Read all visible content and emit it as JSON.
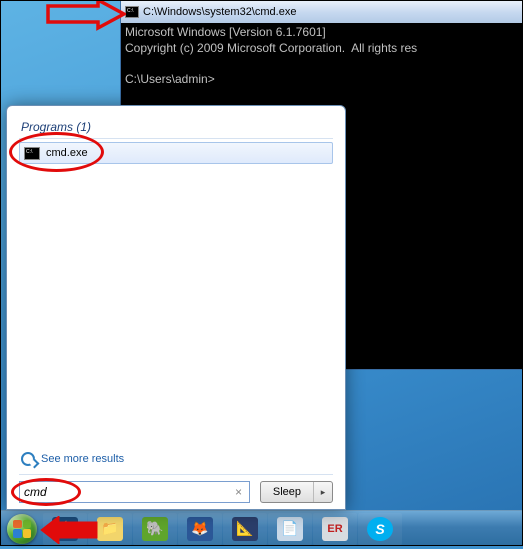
{
  "cmd": {
    "title": "C:\\Windows\\system32\\cmd.exe",
    "line1": "Microsoft Windows [Version 6.1.7601]",
    "line2": "Copyright (c) 2009 Microsoft Corporation.  All rights res",
    "prompt": "C:\\Users\\admin>"
  },
  "startmenu": {
    "heading": "Programs (1)",
    "result_label": "cmd.exe",
    "more_label": "See more results",
    "search_value": "cmd",
    "shutdown_label": "Sleep",
    "shutdown_arrow": "▸"
  },
  "taskbar": {
    "items": [
      {
        "name": "ship-app-icon",
        "bg": "#1a4a7a",
        "glyph": "⛵",
        "color": "#d6c77a"
      },
      {
        "name": "explorer-icon",
        "bg": "#f2d56b",
        "glyph": "📁",
        "color": "#8a6a1a"
      },
      {
        "name": "evernote-icon",
        "bg": "#5fa52c",
        "glyph": "🐘",
        "color": "#fff"
      },
      {
        "name": "firefox-icon",
        "bg": "#2b5797",
        "glyph": "🦊",
        "color": "#e87b2c"
      },
      {
        "name": "matlab-icon",
        "bg": "#2b3e6b",
        "glyph": "📐",
        "color": "#e87b2c"
      },
      {
        "name": "pdf-icon",
        "bg": "#c8d8e8",
        "glyph": "📄",
        "color": "#d02c2c"
      },
      {
        "name": "er-app-icon",
        "bg": "#d8dce0",
        "glyph": "ER",
        "color": "#c02020"
      },
      {
        "name": "skype-icon",
        "bg": "#00aff0",
        "glyph": "S",
        "color": "#fff"
      }
    ]
  }
}
